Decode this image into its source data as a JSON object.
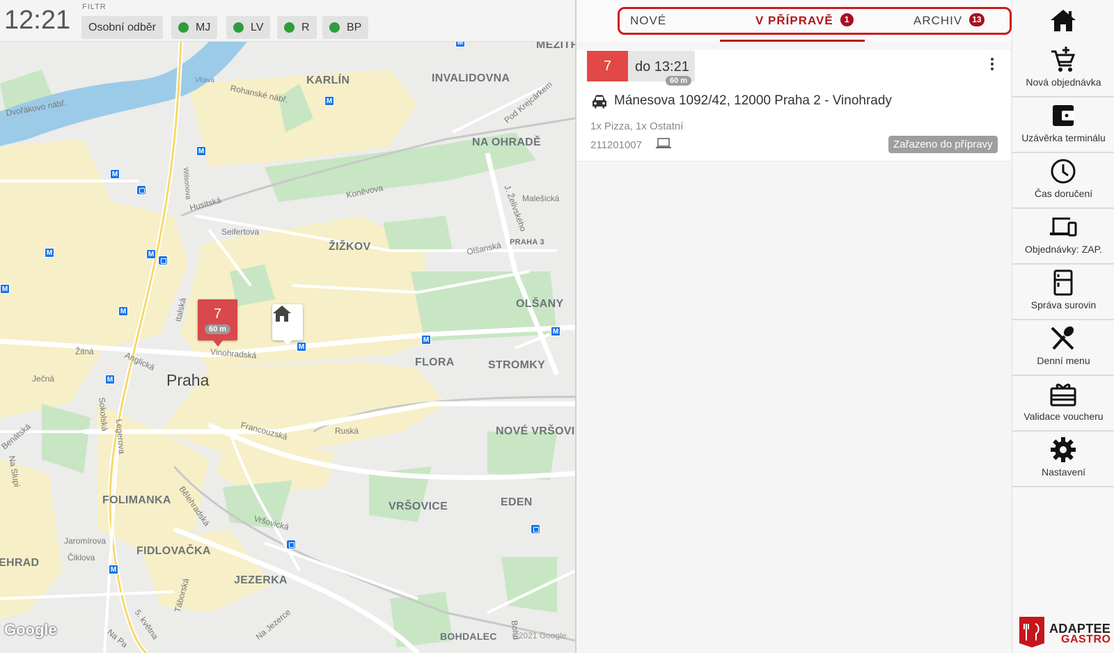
{
  "topbar": {
    "clock": "12:21",
    "filter_label": "FILTR",
    "chips": [
      {
        "label": "Osobní odběr",
        "dot": false
      },
      {
        "label": "MJ",
        "dot": true
      },
      {
        "label": "LV",
        "dot": true
      },
      {
        "label": "R",
        "dot": true
      },
      {
        "label": "BP",
        "dot": true
      }
    ],
    "chip_dot_color": "#2e9d3a"
  },
  "map": {
    "areas": [
      "MEZITR",
      "KARLÍN",
      "INVALIDOVNA",
      "NA OHRADĚ",
      "ŽIŽKOV",
      "PRAHA 3",
      "OLŠANY",
      "FLORA",
      "STROMKY",
      "NOVÉ VRŠOVIC",
      "FOLIMANKA",
      "VRŠOVICE",
      "EDEN",
      "FIDLOVAČKA",
      "JEZERKA",
      "EHRAD",
      "BOHDALEC"
    ],
    "city": "Praha",
    "streets": [
      "Vltava",
      "Rohanské nábř.",
      "Dvořákovo nábř.",
      "Pod Krejcárkem",
      "Wilsonova",
      "Husitská",
      "Koněvova",
      "Malešická",
      "Seifertova",
      "J. Želivského",
      "Olšanská",
      "Italská",
      "Vinohradská",
      "Anglická",
      "Žitná",
      "Ječná",
      "Sokolská",
      "Legerova",
      "Francouzská",
      "Ruská",
      "Bělehradská",
      "Vršovická",
      "Jaromírova",
      "Čiklova",
      "Táborská",
      "Na Jezerce",
      "5. května",
      "Benátská",
      "Na Slupi",
      "Na Pa",
      "Bohd"
    ],
    "order_pin": {
      "number": "7",
      "duration": "60 m"
    },
    "google_logo": "Google",
    "copyright": "©2021 Google",
    "colors": {
      "pin": "#d9484a",
      "water": "#9ccbe8",
      "park": "#c8e6c4",
      "residential": "#f7efc7",
      "metro": "#1a73e8"
    }
  },
  "orders": {
    "tabs": [
      {
        "label": "NOVÉ",
        "badge": ""
      },
      {
        "label": "V PŘÍPRAVĚ",
        "badge": "1"
      },
      {
        "label": "ARCHIV",
        "badge": "13"
      }
    ],
    "active_tab": "V PŘÍPRAVĚ",
    "card": {
      "number": "7",
      "deadline": "do 13:21",
      "duration": "60 m",
      "address": "Mánesova 1092/42, 12000 Praha 2 - Vinohrady",
      "items": "1x Pizza, 1x Ostatní",
      "order_id": "211201007",
      "status": "Zařazeno do přípravy",
      "delivery_icon": "car-icon",
      "source_icon": "laptop-icon"
    },
    "accent_color": "#b01818"
  },
  "sidebar": {
    "home_icon": "home-icon",
    "items": [
      {
        "label": "Nová objednávka",
        "icon": "cart-add-icon"
      },
      {
        "label": "Uzávěrka terminálu",
        "icon": "wallet-icon"
      },
      {
        "label": "Čas doručení",
        "icon": "clock-icon"
      },
      {
        "label": "Objednávky: ZAP.",
        "icon": "devices-icon"
      },
      {
        "label": "Správa surovin",
        "icon": "fridge-icon"
      },
      {
        "label": "Denní menu",
        "icon": "cutlery-icon"
      },
      {
        "label": "Validace voucheru",
        "icon": "gift-icon"
      },
      {
        "label": "Nastavení",
        "icon": "gear-icon"
      }
    ],
    "brand": {
      "line1": "ADAPTEE",
      "line2": "GASTRO",
      "color": "#c4161c"
    }
  }
}
